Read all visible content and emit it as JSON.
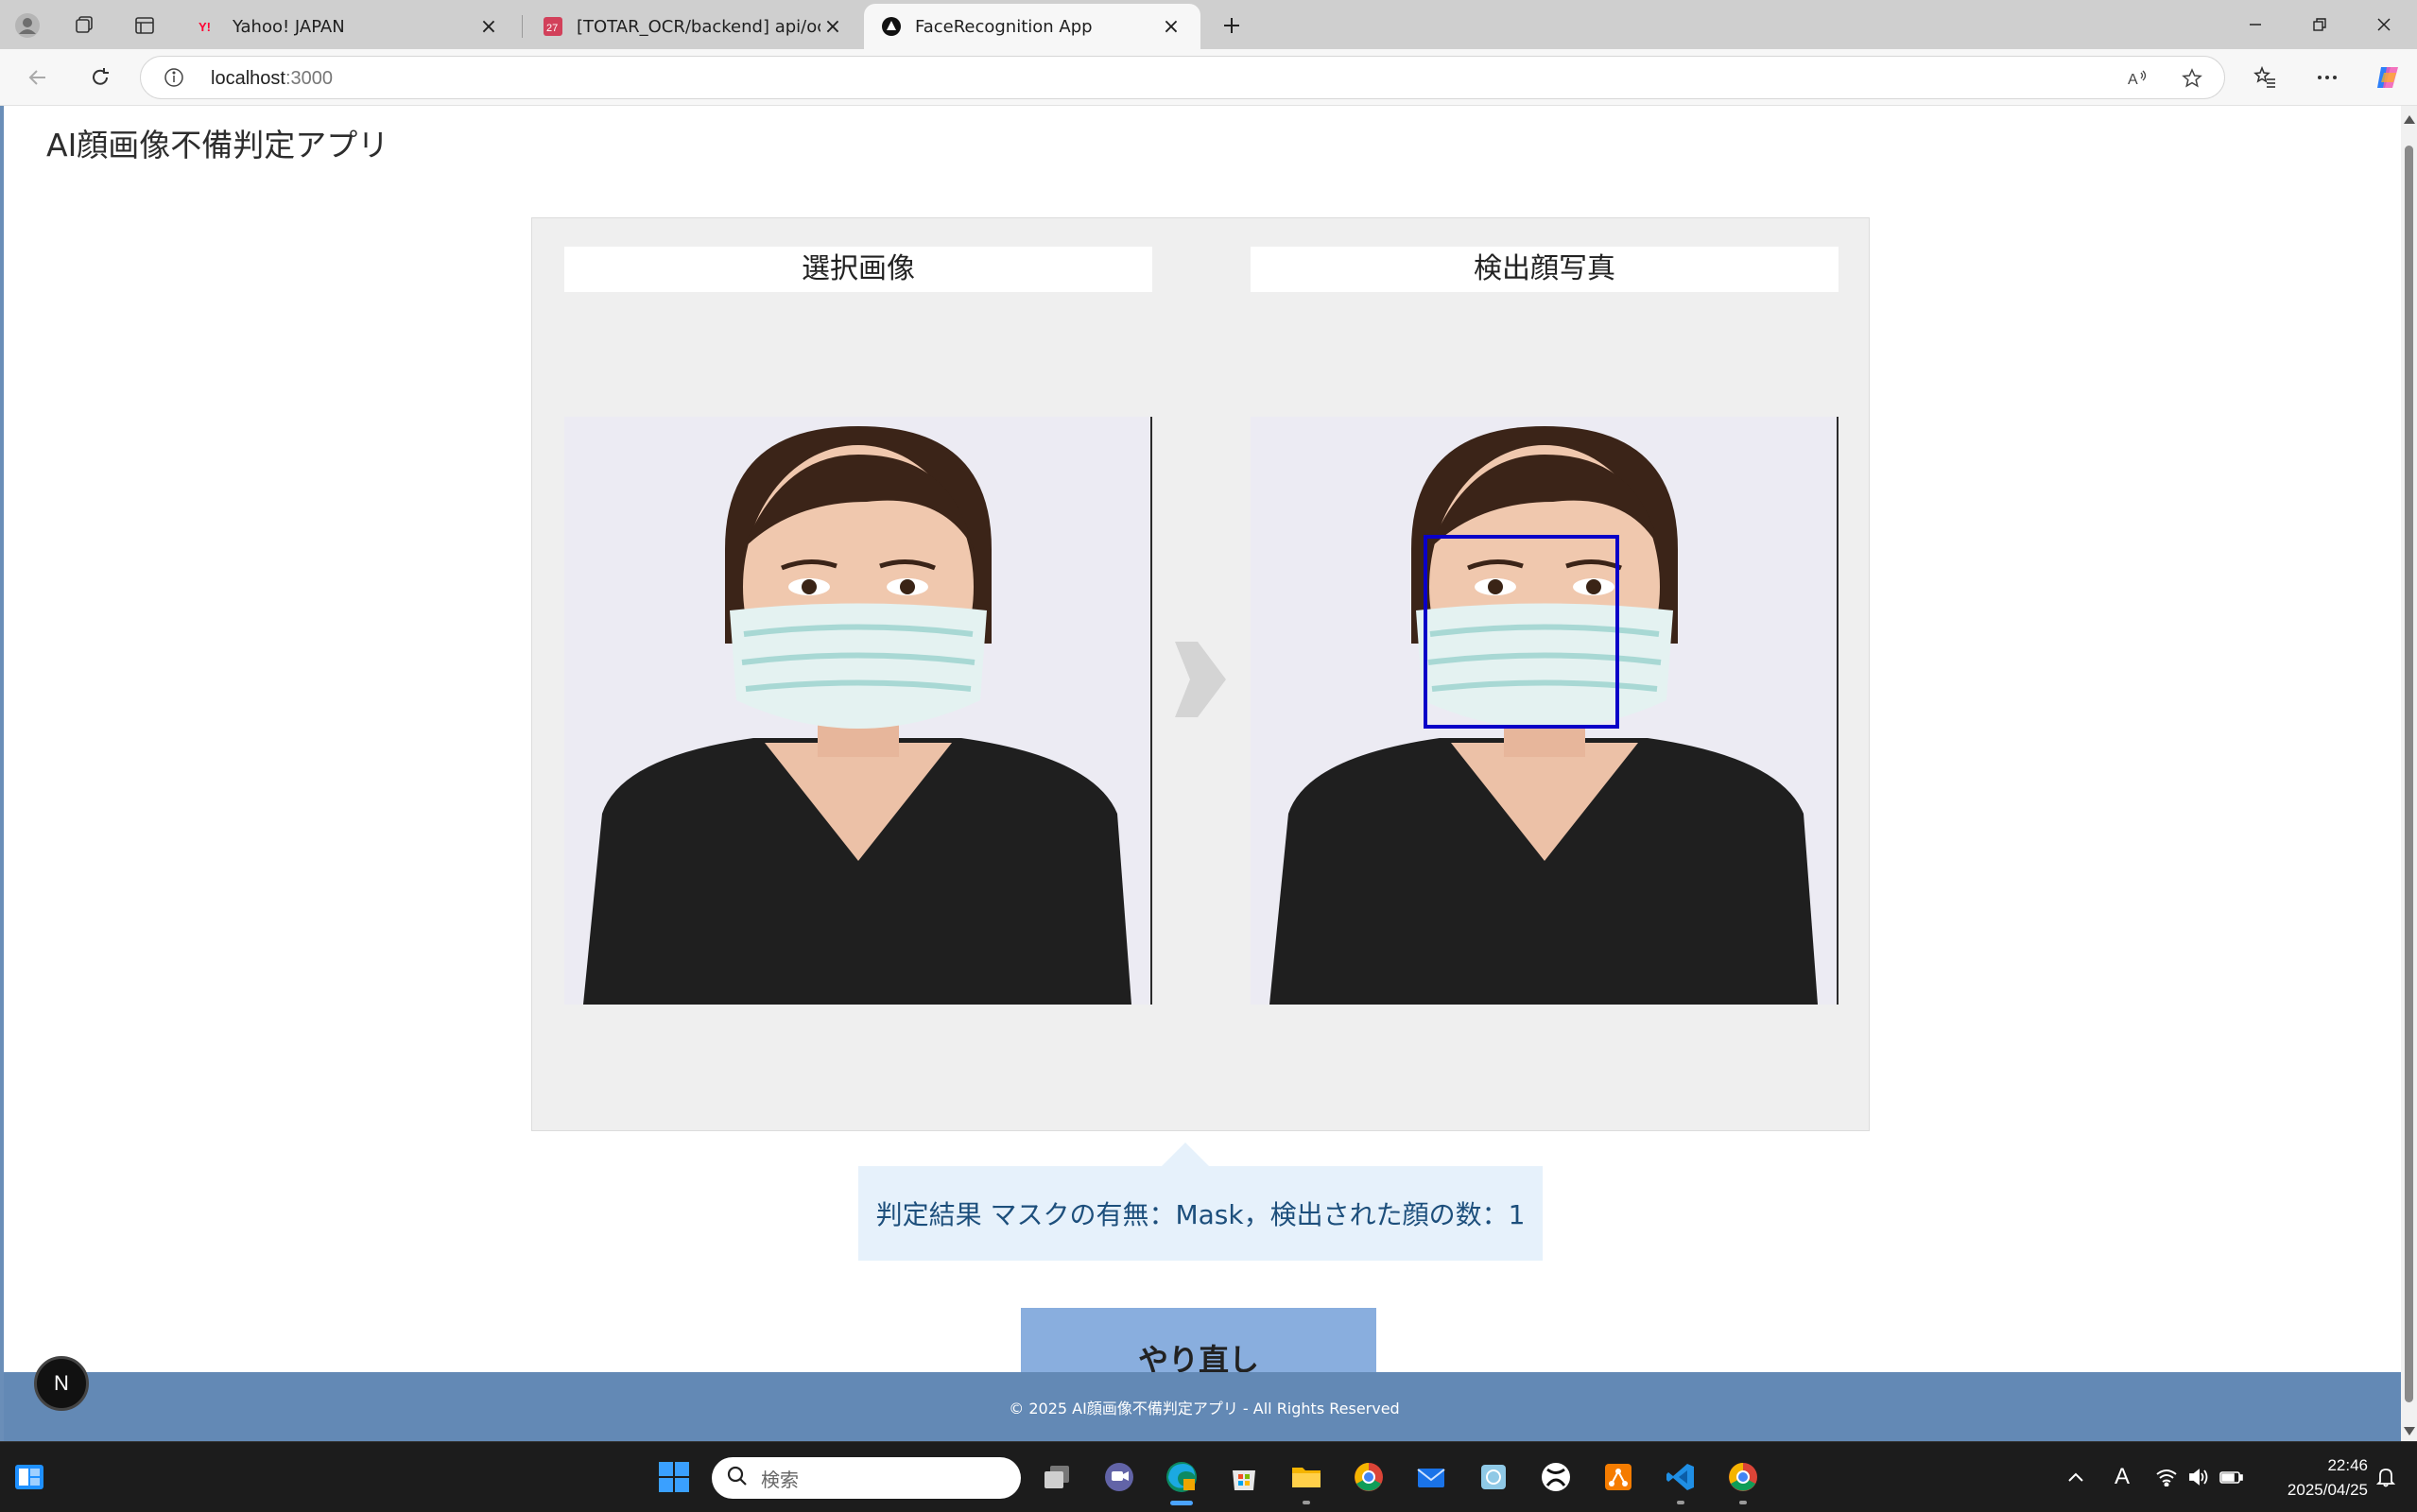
{
  "browser": {
    "tabs": [
      {
        "title": "Yahoo! JAPAN",
        "favicon": "yahoo-favicon",
        "active": false
      },
      {
        "title": "[TOTAR_OCR/backend] api/ocr.py",
        "favicon": "gitlab-favicon",
        "active": false
      },
      {
        "title": "FaceRecognition App",
        "favicon": "nextjs-favicon",
        "active": true
      }
    ],
    "url_host": "localhost",
    "url_port": ":3000"
  },
  "app": {
    "title": "AI顔画像不備判定アプリ",
    "panels": {
      "selected_label": "選択画像",
      "detected_label": "検出顔写真"
    },
    "result_text": "判定結果 マスクの有無：Mask，検出された顔の数：1",
    "retry_label": "やり直し",
    "footer": "© 2025 AI顔画像不備判定アプリ - All Rights Reserved",
    "dev_badge": "N",
    "face_box_color": "#0a00c8"
  },
  "taskbar": {
    "search_placeholder": "検索",
    "time": "22:46",
    "date": "2025/04/25",
    "ime": "A"
  },
  "colors": {
    "accent": "#6389b5",
    "result_bg": "#e6f1fb",
    "result_text": "#1d4f7c",
    "button_bg": "#89aede"
  }
}
